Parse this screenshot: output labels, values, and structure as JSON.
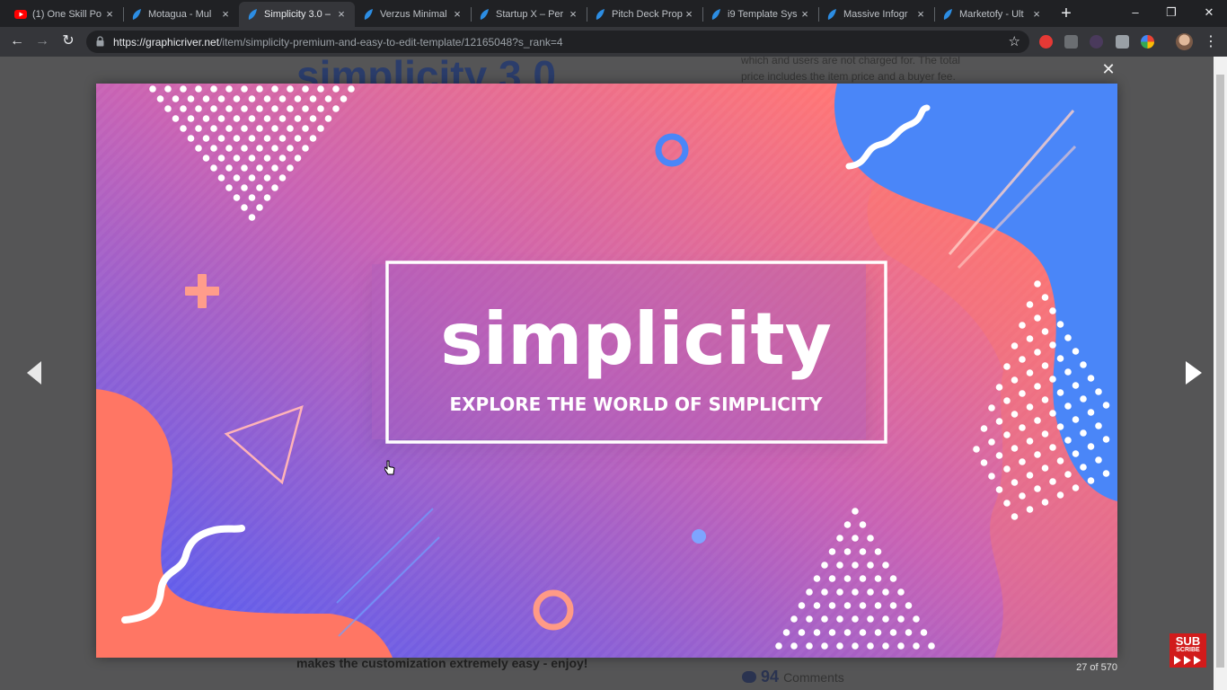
{
  "tabs": [
    {
      "title": "(1) One Skill Po",
      "favicon": "youtube-icon",
      "active": false
    },
    {
      "title": "Motagua - Mul",
      "favicon": "envato-leaf-icon",
      "active": false
    },
    {
      "title": "Simplicity 3.0 –",
      "favicon": "envato-leaf-icon",
      "active": true
    },
    {
      "title": "Verzus Minimal",
      "favicon": "envato-leaf-icon",
      "active": false
    },
    {
      "title": "Startup X – Per",
      "favicon": "envato-leaf-icon",
      "active": false
    },
    {
      "title": "Pitch Deck Prop",
      "favicon": "envato-leaf-icon",
      "active": false
    },
    {
      "title": "i9 Template Sys",
      "favicon": "envato-leaf-icon",
      "active": false
    },
    {
      "title": "Massive Infogr",
      "favicon": "envato-leaf-icon",
      "active": false
    },
    {
      "title": "Marketofy - Ult",
      "favicon": "envato-leaf-icon",
      "active": false
    }
  ],
  "new_tab": "+",
  "window_controls": {
    "minimize": "–",
    "restore": "❐",
    "close": "✕"
  },
  "toolbar": {
    "back": "←",
    "forward": "→",
    "reload": "↻",
    "url_host": "https://graphicriver.net",
    "url_path": "/item/simplicity-premium-and-easy-to-edit-template/12165048?s_rank=4",
    "bookmark_star": "☆",
    "menu": "⋮"
  },
  "background_page": {
    "heading": "simplicity 3.0",
    "side_text_line1": "which and users are not charged for. The total",
    "side_text_line2": "price includes the item price and a buyer fee.",
    "bottom_text": "makes the customization extremely easy - enjoy!",
    "comments_count": "94",
    "comments_label": "Comments"
  },
  "lightbox": {
    "close": "✕",
    "counter": "27 of 570",
    "preview": {
      "title": "simplicity",
      "subtitle": "EXPLORE THE WORLD OF SIMPLICITY"
    }
  },
  "subscribe_badge": {
    "line1": "SUB",
    "line2": "SCRIBE"
  },
  "colors": {
    "gradient_start": "#5a5bf5",
    "gradient_mid": "#c561b8",
    "gradient_end": "#ff7474",
    "coral": "#ff7563",
    "blue_blob": "#4a85f7",
    "overlay": "#555556"
  }
}
